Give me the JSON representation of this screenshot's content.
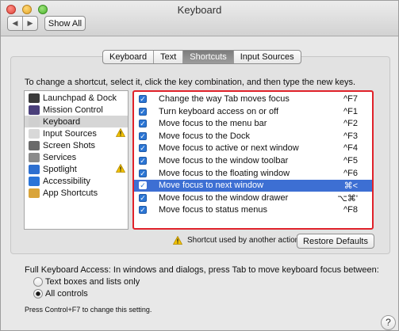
{
  "window": {
    "title": "Keyboard"
  },
  "toolbar": {
    "back_icon": "◀",
    "forward_icon": "▶",
    "show_all_label": "Show All"
  },
  "tabs": [
    {
      "label": "Keyboard",
      "selected": false
    },
    {
      "label": "Text",
      "selected": false
    },
    {
      "label": "Shortcuts",
      "selected": true
    },
    {
      "label": "Input Sources",
      "selected": false
    }
  ],
  "instructions": "To change a shortcut, select it, click the key combination, and then type the new keys.",
  "categories": [
    {
      "label": "Launchpad & Dock",
      "icon": "launchpad-dock-icon",
      "color": "#3a3a3a",
      "warning": false,
      "selected": false
    },
    {
      "label": "Mission Control",
      "icon": "mission-control-icon",
      "color": "#4a3f7a",
      "warning": false,
      "selected": false
    },
    {
      "label": "Keyboard",
      "icon": "keyboard-icon",
      "color": "#cfcfcf",
      "warning": false,
      "selected": true
    },
    {
      "label": "Input Sources",
      "icon": "input-sources-icon",
      "color": "#d8d8d8",
      "warning": true,
      "selected": false
    },
    {
      "label": "Screen Shots",
      "icon": "screen-shots-icon",
      "color": "#6a6a6a",
      "warning": false,
      "selected": false
    },
    {
      "label": "Services",
      "icon": "services-gear-icon",
      "color": "#8a8a8a",
      "warning": false,
      "selected": false
    },
    {
      "label": "Spotlight",
      "icon": "spotlight-icon",
      "color": "#2d6fd0",
      "warning": true,
      "selected": false
    },
    {
      "label": "Accessibility",
      "icon": "accessibility-icon",
      "color": "#2a74d8",
      "warning": false,
      "selected": false
    },
    {
      "label": "App Shortcuts",
      "icon": "app-shortcuts-icon",
      "color": "#d9a43a",
      "warning": false,
      "selected": false
    }
  ],
  "shortcuts": [
    {
      "label": "Change the way Tab moves focus",
      "key": "^F7",
      "checked": true,
      "selected": false
    },
    {
      "label": "Turn keyboard access on or off",
      "key": "^F1",
      "checked": true,
      "selected": false
    },
    {
      "label": "Move focus to the menu bar",
      "key": "^F2",
      "checked": true,
      "selected": false
    },
    {
      "label": "Move focus to the Dock",
      "key": "^F3",
      "checked": true,
      "selected": false
    },
    {
      "label": "Move focus to active or next window",
      "key": "^F4",
      "checked": true,
      "selected": false
    },
    {
      "label": "Move focus to the window toolbar",
      "key": "^F5",
      "checked": true,
      "selected": false
    },
    {
      "label": "Move focus to the floating window",
      "key": "^F6",
      "checked": true,
      "selected": false
    },
    {
      "label": "Move focus to next window",
      "key": "⌘<",
      "checked": true,
      "selected": true
    },
    {
      "label": "Move focus to the window drawer",
      "key": "⌥⌘'",
      "checked": true,
      "selected": false
    },
    {
      "label": "Move focus to status menus",
      "key": "^F8",
      "checked": true,
      "selected": false
    }
  ],
  "conflict_note": "Shortcut used by another action",
  "restore_label": "Restore Defaults",
  "full_keyboard_access": {
    "label": "Full Keyboard Access: In windows and dialogs, press Tab to move keyboard focus between:",
    "options": [
      {
        "label": "Text boxes and lists only",
        "selected": false
      },
      {
        "label": "All controls",
        "selected": true
      }
    ],
    "hint": "Press Control+F7 to change this setting."
  },
  "help_label": "?",
  "colors": {
    "selection": "#3d6fd3",
    "highlight_border": "#e0222a",
    "warning": "#f2c200"
  }
}
